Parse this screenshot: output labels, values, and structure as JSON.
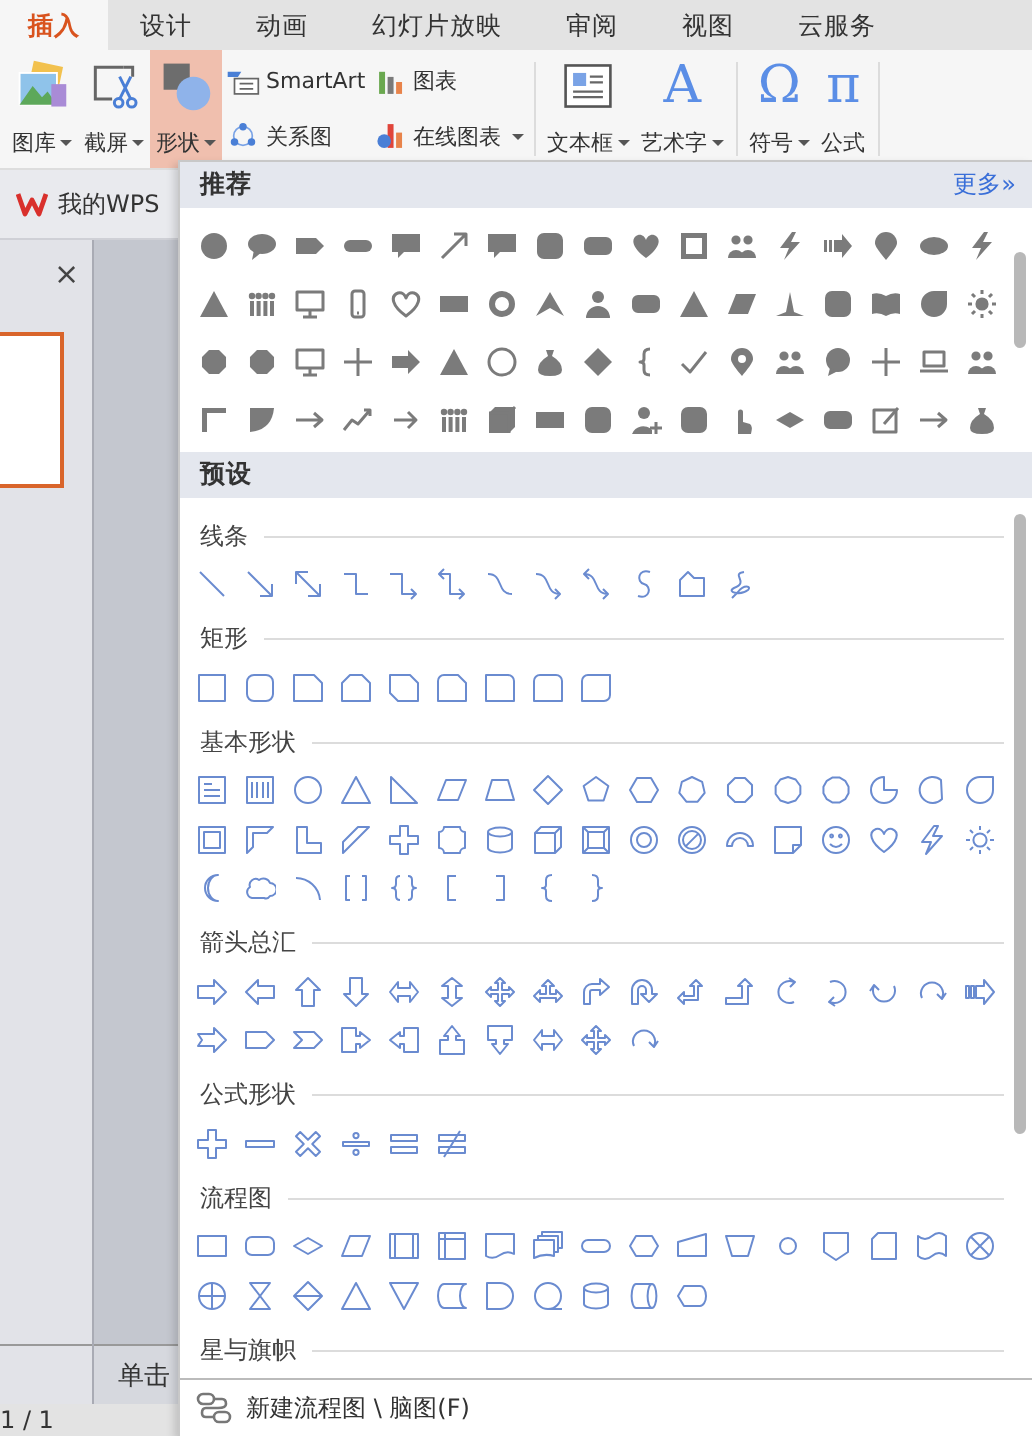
{
  "tabs": [
    {
      "label": "插入",
      "selected": true
    },
    {
      "label": "设计",
      "selected": false
    },
    {
      "label": "动画",
      "selected": false
    },
    {
      "label": "幻灯片放映",
      "selected": false
    },
    {
      "label": "审阅",
      "selected": false
    },
    {
      "label": "视图",
      "selected": false
    },
    {
      "label": "云服务",
      "selected": false
    }
  ],
  "ribbon": [
    {
      "kind": "large",
      "label": "图库",
      "dropdown": true,
      "selected": false
    },
    {
      "kind": "large",
      "label": "截屏",
      "dropdown": true,
      "selected": false
    },
    {
      "kind": "large",
      "label": "形状",
      "dropdown": true,
      "selected": true
    },
    {
      "kind": "stack",
      "items": [
        {
          "label": "SmartArt",
          "dropdown": false
        },
        {
          "label": "关系图",
          "dropdown": false
        }
      ]
    },
    {
      "kind": "stack",
      "items": [
        {
          "label": "图表",
          "dropdown": false
        },
        {
          "label": "在线图表",
          "dropdown": true
        }
      ]
    },
    {
      "kind": "separator"
    },
    {
      "kind": "large",
      "label": "文本框",
      "dropdown": true,
      "selected": false
    },
    {
      "kind": "large",
      "label": "艺术字",
      "glyph": "A",
      "dropdown": true,
      "selected": false
    },
    {
      "kind": "separator"
    },
    {
      "kind": "large",
      "label": "符号",
      "glyph": "Ω",
      "dropdown": true,
      "selected": false
    },
    {
      "kind": "large",
      "label": "公式",
      "glyph": "π",
      "dropdown": false,
      "selected": false
    },
    {
      "kind": "separator"
    }
  ],
  "doc_tab": {
    "label": "我的WPS"
  },
  "slide_pane": {
    "close": "×"
  },
  "slide_hint": "单击",
  "status_bar": {
    "page": "1 / 1"
  },
  "shape_panel": {
    "recommended": {
      "title": "推荐",
      "more": "更多»"
    },
    "preset": {
      "title": "预设",
      "sections": [
        {
          "title": "线条"
        },
        {
          "title": "矩形"
        },
        {
          "title": "基本形状"
        },
        {
          "title": "箭头总汇"
        },
        {
          "title": "公式形状"
        },
        {
          "title": "流程图"
        },
        {
          "title": "星与旗帜"
        }
      ]
    },
    "footer": {
      "label": "新建流程图 \\ 脑图(F)"
    }
  }
}
